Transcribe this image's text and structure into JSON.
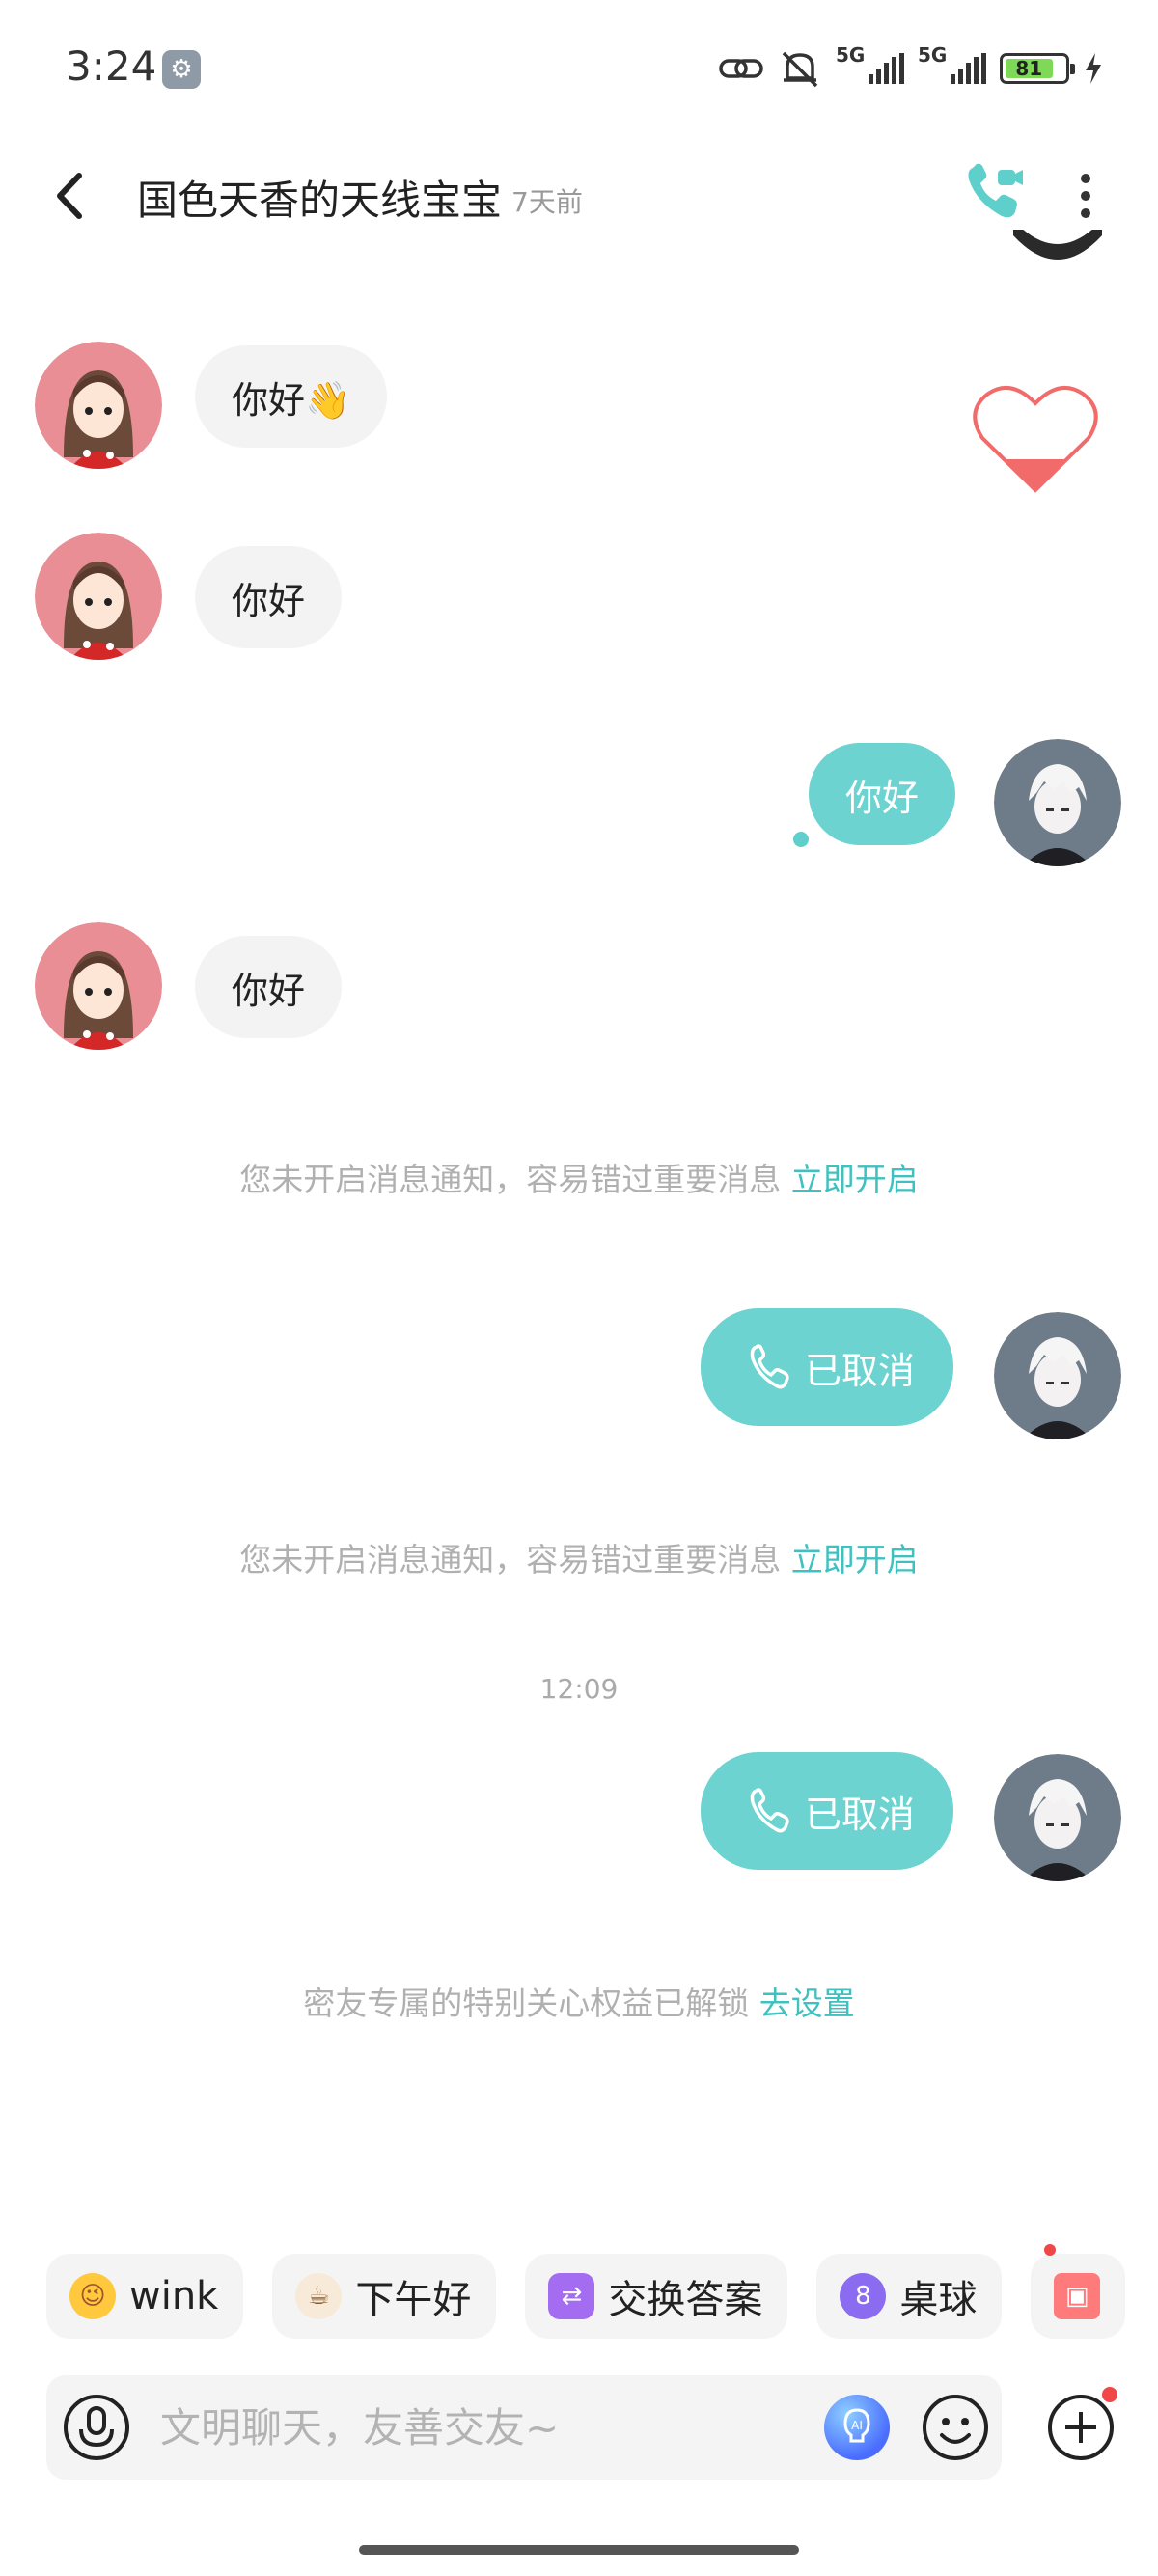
{
  "status_bar": {
    "time": "3:24",
    "signal1_label": "5G",
    "signal2_label": "5G",
    "battery": "81"
  },
  "header": {
    "title": "国色天香的天线宝宝",
    "last_seen": "7天前"
  },
  "messages": [
    {
      "side": "in",
      "text": "你好👋"
    },
    {
      "side": "in",
      "text": "你好"
    },
    {
      "side": "out",
      "text": "你好"
    },
    {
      "side": "in",
      "text": "你好"
    }
  ],
  "notices": [
    {
      "text": "您未开启消息通知，容易错过重要消息",
      "link": "立即开启"
    },
    {
      "text": "您未开启消息通知，容易错过重要消息",
      "link": "立即开启"
    },
    {
      "text": "密友专属的特别关心权益已解锁",
      "link": "去设置"
    }
  ],
  "calls": [
    {
      "label": "已取消"
    },
    {
      "label": "已取消"
    }
  ],
  "timestamp": "12:09",
  "chips": [
    {
      "label": "wink",
      "icon": "wink-emoji-icon",
      "color": "#ffc83d"
    },
    {
      "label": "下午好",
      "icon": "coffee-icon",
      "color": "#c98a4b"
    },
    {
      "label": "交换答案",
      "icon": "exchange-icon",
      "color": "#a46cf0"
    },
    {
      "label": "桌球",
      "icon": "billiards-icon",
      "color": "#8b6cf0"
    },
    {
      "label": "",
      "icon": "gift-icon",
      "color": "#ff7a7a"
    }
  ],
  "input": {
    "placeholder": "文明聊天，友善交友~"
  },
  "colors": {
    "accent": "#6cd3d0",
    "link": "#3fc1c0",
    "incoming_bubble": "#f3f3f3"
  }
}
